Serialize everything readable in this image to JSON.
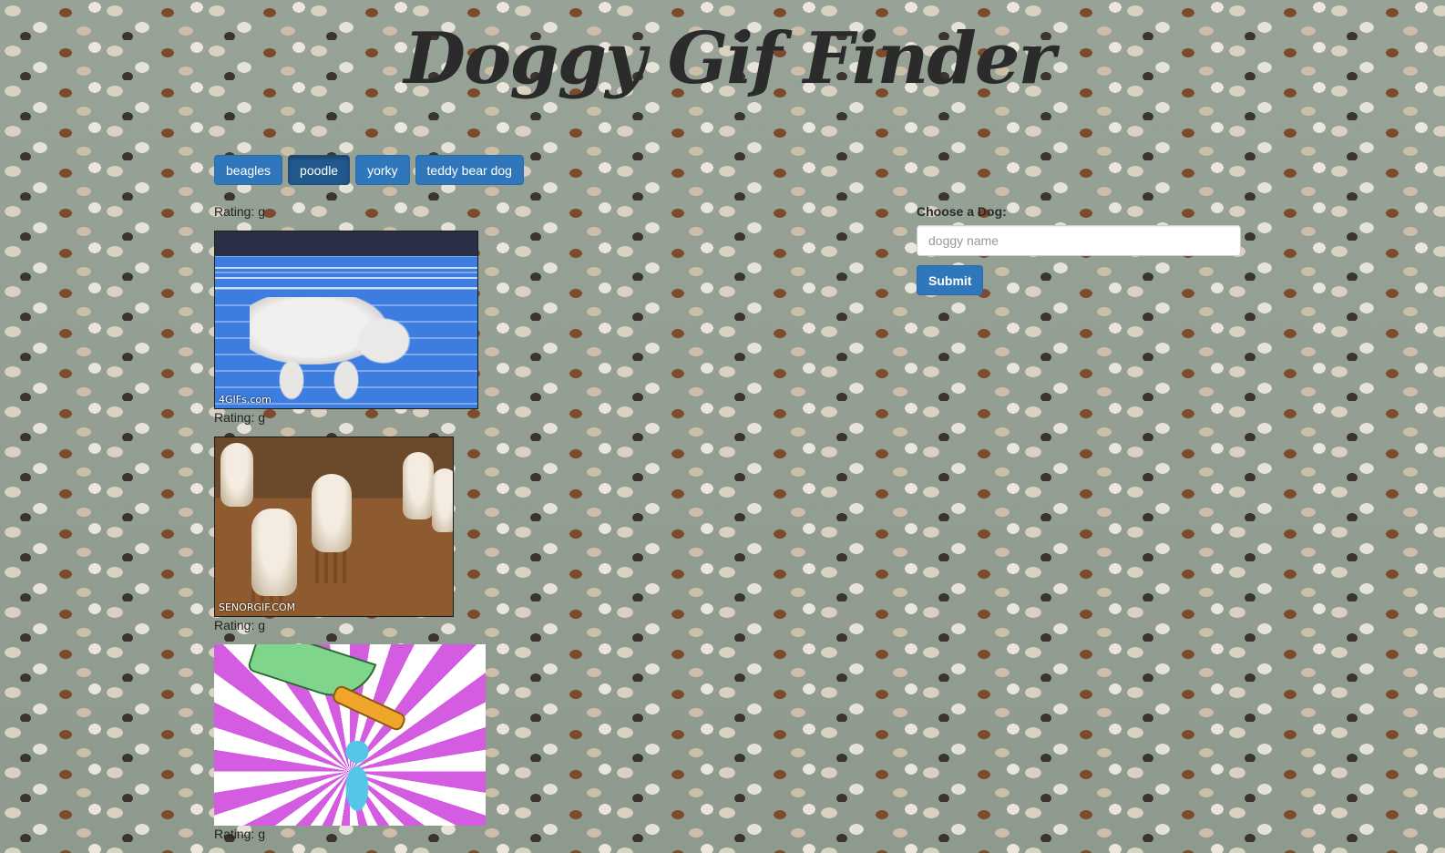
{
  "header": {
    "title": "Doggy Gif Finder"
  },
  "dog_buttons": [
    {
      "label": "beagles",
      "active": false
    },
    {
      "label": "poodle",
      "active": true
    },
    {
      "label": "yorky",
      "active": false
    },
    {
      "label": "teddy bear dog",
      "active": false
    }
  ],
  "results": [
    {
      "rating_text": "Rating: g",
      "watermark": "4GIFs.com"
    },
    {
      "rating_text": "Rating: g",
      "watermark": "SENORGIF.COM"
    },
    {
      "rating_text": "Rating: g",
      "watermark": ""
    },
    {
      "rating_text": "Rating: g"
    }
  ],
  "form": {
    "label": "Choose a Dog:",
    "input_placeholder": "doggy name",
    "input_value": "",
    "submit_label": "Submit"
  },
  "colors": {
    "button": "#2f76ba",
    "button_active": "#22598d",
    "background": "#949f93"
  }
}
